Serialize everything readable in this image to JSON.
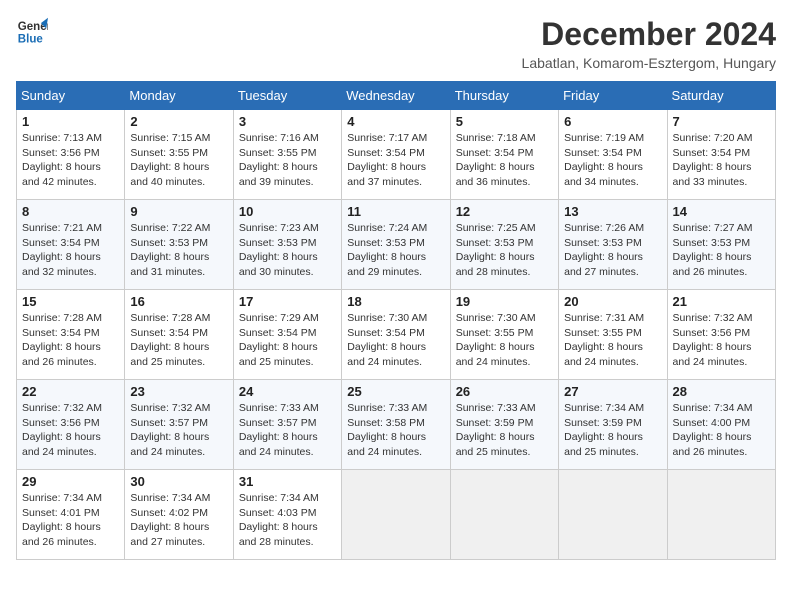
{
  "header": {
    "logo_line1": "General",
    "logo_line2": "Blue",
    "month": "December 2024",
    "location": "Labatlan, Komarom-Esztergom, Hungary"
  },
  "weekdays": [
    "Sunday",
    "Monday",
    "Tuesday",
    "Wednesday",
    "Thursday",
    "Friday",
    "Saturday"
  ],
  "weeks": [
    [
      {
        "day": "1",
        "info": "Sunrise: 7:13 AM\nSunset: 3:56 PM\nDaylight: 8 hours and 42 minutes."
      },
      {
        "day": "2",
        "info": "Sunrise: 7:15 AM\nSunset: 3:55 PM\nDaylight: 8 hours and 40 minutes."
      },
      {
        "day": "3",
        "info": "Sunrise: 7:16 AM\nSunset: 3:55 PM\nDaylight: 8 hours and 39 minutes."
      },
      {
        "day": "4",
        "info": "Sunrise: 7:17 AM\nSunset: 3:54 PM\nDaylight: 8 hours and 37 minutes."
      },
      {
        "day": "5",
        "info": "Sunrise: 7:18 AM\nSunset: 3:54 PM\nDaylight: 8 hours and 36 minutes."
      },
      {
        "day": "6",
        "info": "Sunrise: 7:19 AM\nSunset: 3:54 PM\nDaylight: 8 hours and 34 minutes."
      },
      {
        "day": "7",
        "info": "Sunrise: 7:20 AM\nSunset: 3:54 PM\nDaylight: 8 hours and 33 minutes."
      }
    ],
    [
      {
        "day": "8",
        "info": "Sunrise: 7:21 AM\nSunset: 3:54 PM\nDaylight: 8 hours and 32 minutes."
      },
      {
        "day": "9",
        "info": "Sunrise: 7:22 AM\nSunset: 3:53 PM\nDaylight: 8 hours and 31 minutes."
      },
      {
        "day": "10",
        "info": "Sunrise: 7:23 AM\nSunset: 3:53 PM\nDaylight: 8 hours and 30 minutes."
      },
      {
        "day": "11",
        "info": "Sunrise: 7:24 AM\nSunset: 3:53 PM\nDaylight: 8 hours and 29 minutes."
      },
      {
        "day": "12",
        "info": "Sunrise: 7:25 AM\nSunset: 3:53 PM\nDaylight: 8 hours and 28 minutes."
      },
      {
        "day": "13",
        "info": "Sunrise: 7:26 AM\nSunset: 3:53 PM\nDaylight: 8 hours and 27 minutes."
      },
      {
        "day": "14",
        "info": "Sunrise: 7:27 AM\nSunset: 3:53 PM\nDaylight: 8 hours and 26 minutes."
      }
    ],
    [
      {
        "day": "15",
        "info": "Sunrise: 7:28 AM\nSunset: 3:54 PM\nDaylight: 8 hours and 26 minutes."
      },
      {
        "day": "16",
        "info": "Sunrise: 7:28 AM\nSunset: 3:54 PM\nDaylight: 8 hours and 25 minutes."
      },
      {
        "day": "17",
        "info": "Sunrise: 7:29 AM\nSunset: 3:54 PM\nDaylight: 8 hours and 25 minutes."
      },
      {
        "day": "18",
        "info": "Sunrise: 7:30 AM\nSunset: 3:54 PM\nDaylight: 8 hours and 24 minutes."
      },
      {
        "day": "19",
        "info": "Sunrise: 7:30 AM\nSunset: 3:55 PM\nDaylight: 8 hours and 24 minutes."
      },
      {
        "day": "20",
        "info": "Sunrise: 7:31 AM\nSunset: 3:55 PM\nDaylight: 8 hours and 24 minutes."
      },
      {
        "day": "21",
        "info": "Sunrise: 7:32 AM\nSunset: 3:56 PM\nDaylight: 8 hours and 24 minutes."
      }
    ],
    [
      {
        "day": "22",
        "info": "Sunrise: 7:32 AM\nSunset: 3:56 PM\nDaylight: 8 hours and 24 minutes."
      },
      {
        "day": "23",
        "info": "Sunrise: 7:32 AM\nSunset: 3:57 PM\nDaylight: 8 hours and 24 minutes."
      },
      {
        "day": "24",
        "info": "Sunrise: 7:33 AM\nSunset: 3:57 PM\nDaylight: 8 hours and 24 minutes."
      },
      {
        "day": "25",
        "info": "Sunrise: 7:33 AM\nSunset: 3:58 PM\nDaylight: 8 hours and 24 minutes."
      },
      {
        "day": "26",
        "info": "Sunrise: 7:33 AM\nSunset: 3:59 PM\nDaylight: 8 hours and 25 minutes."
      },
      {
        "day": "27",
        "info": "Sunrise: 7:34 AM\nSunset: 3:59 PM\nDaylight: 8 hours and 25 minutes."
      },
      {
        "day": "28",
        "info": "Sunrise: 7:34 AM\nSunset: 4:00 PM\nDaylight: 8 hours and 26 minutes."
      }
    ],
    [
      {
        "day": "29",
        "info": "Sunrise: 7:34 AM\nSunset: 4:01 PM\nDaylight: 8 hours and 26 minutes."
      },
      {
        "day": "30",
        "info": "Sunrise: 7:34 AM\nSunset: 4:02 PM\nDaylight: 8 hours and 27 minutes."
      },
      {
        "day": "31",
        "info": "Sunrise: 7:34 AM\nSunset: 4:03 PM\nDaylight: 8 hours and 28 minutes."
      },
      null,
      null,
      null,
      null
    ]
  ]
}
